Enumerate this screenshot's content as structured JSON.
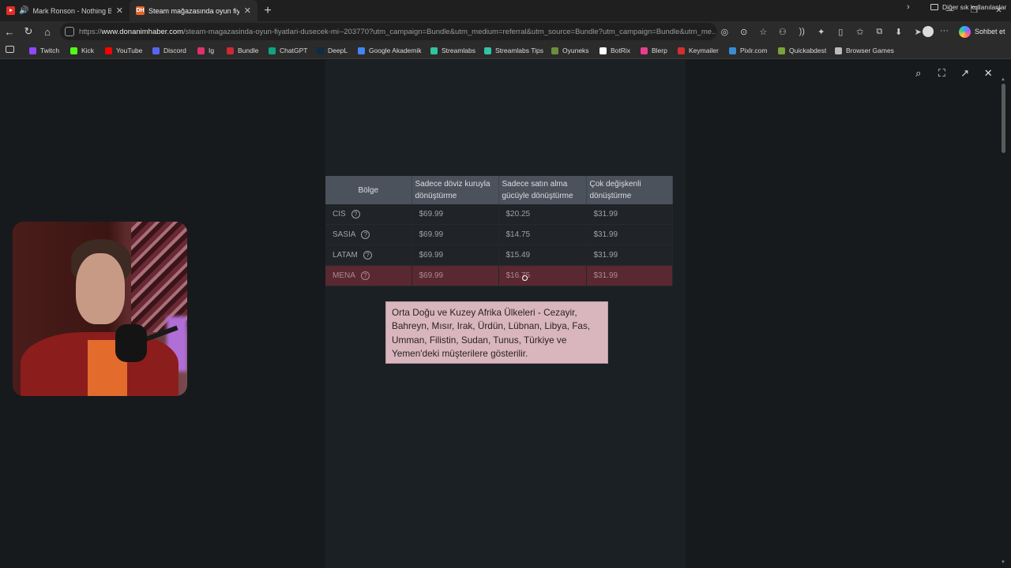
{
  "browser": {
    "tabs": [
      {
        "title": "Mark Ronson - Nothing Breaks",
        "icon": "youtube-icon",
        "active": false
      },
      {
        "title": "Steam mağazasında oyun fiyatları",
        "icon": "DH",
        "active": true
      }
    ],
    "url_host": "www.donanimhaber.com",
    "url_rest": "/steam-magazasinda-oyun-fiyatlari-dusecek-mi--203770?utm_campaign=Bundle&utm_medium=referral&utm_source=Bundle?utm_campaign=Bundle&utm_me...",
    "url_prefix": "https://",
    "copilot_label": "Sohbet et",
    "bookmarks": [
      "Twitch",
      "Kick",
      "YouTube",
      "Discord",
      "Ig",
      "Bundle",
      "ChatGPT",
      "DeepL",
      "Google Akademik",
      "Streamlabs",
      "Streamlabs Tips",
      "Oyuneks",
      "BotRix",
      "Blerp",
      "Keymailer",
      "Pixlr.com",
      "Quickabdest",
      "Browser Games"
    ],
    "bookmark_colors": [
      "#9146ff",
      "#53fc18",
      "#ff0000",
      "#5865f2",
      "#e1306c",
      "#cc2936",
      "#10a37f",
      "#0f2b46",
      "#4285f4",
      "#31c3a2",
      "#31c3a2",
      "#6a8f3a",
      "#ffffff",
      "#e83e8c",
      "#d32f2f",
      "#3b8bd4",
      "#7aa33a",
      "#bbbbbb"
    ],
    "other_bookmarks": "Diğer sık kullanılanlar"
  },
  "table": {
    "headers": [
      "Bölge",
      "Sadece döviz kuruyla dönüştürme",
      "Sadece satın alma gücüyle dönüştürme",
      "Çok değişkenli dönüştürme"
    ],
    "rows": [
      {
        "region": "CIS",
        "fx": "$69.99",
        "ppp": "$20.25",
        "multi": "$31.99"
      },
      {
        "region": "SASIA",
        "fx": "$69.99",
        "ppp": "$14.75",
        "multi": "$31.99"
      },
      {
        "region": "LATAM",
        "fx": "$69.99",
        "ppp": "$15.49",
        "multi": "$31.99"
      },
      {
        "region": "MENA",
        "fx": "$69.99",
        "ppp": "$16.75",
        "multi": "$31.99"
      }
    ],
    "highlight_color": "#5a2830"
  },
  "tooltip": {
    "text": "Orta Doğu ve Kuzey Afrika Ülkeleri - Cezayir, Bahreyn, Mısır, Irak, Ürdün, Lübnan, Libya, Fas, Umman, Filistin, Sudan, Tunus, Türkiye ve Yemen'deki müşterilere gösterilir."
  }
}
